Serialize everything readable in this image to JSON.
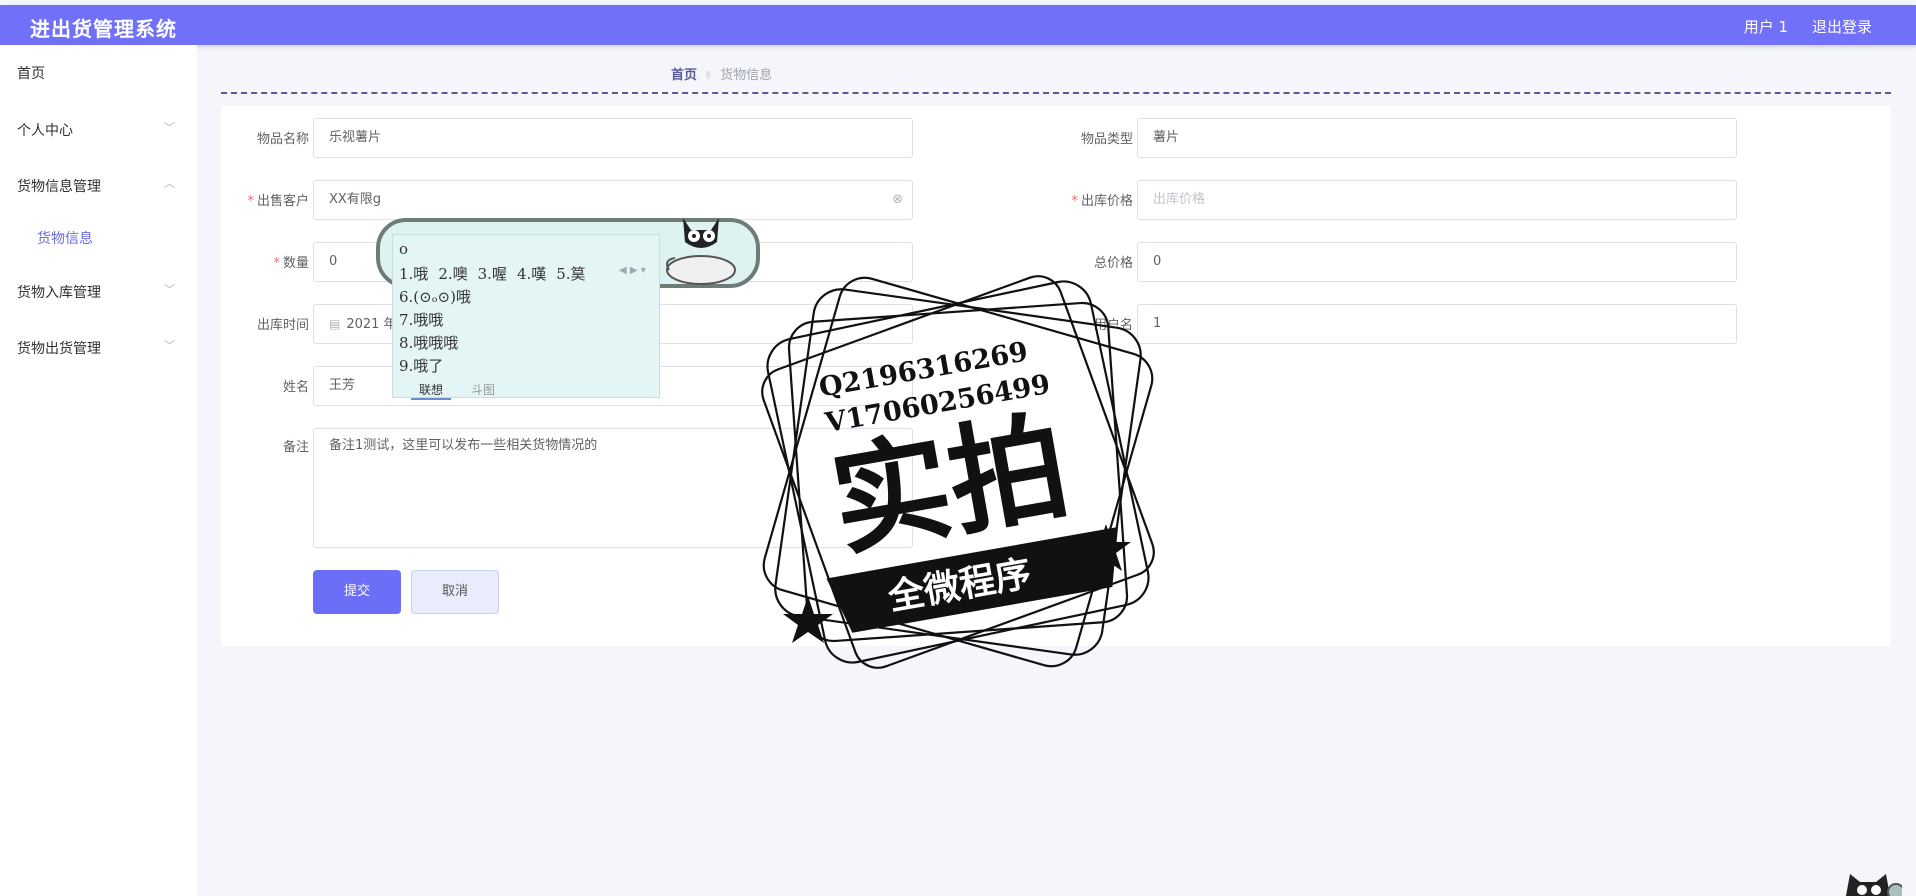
{
  "header": {
    "title": "进出货管理系统",
    "user": "用户 1",
    "logout": "退出登录"
  },
  "sidebar": {
    "items": [
      {
        "label": "首页",
        "has_chevron": false
      },
      {
        "label": "个人中心",
        "has_chevron": true,
        "chevron": "chevron-down-icon"
      },
      {
        "label": "货物信息管理",
        "has_chevron": true,
        "chevron": "chevron-up-icon"
      },
      {
        "label": "货物信息",
        "sub": true
      },
      {
        "label": "货物入库管理",
        "has_chevron": true,
        "chevron": "chevron-down-icon"
      },
      {
        "label": "货物出货管理",
        "has_chevron": true,
        "chevron": "chevron-down-icon"
      }
    ]
  },
  "breadcrumb": {
    "home": "首页",
    "current": "货物信息"
  },
  "form": {
    "item_name": {
      "label": "物品名称",
      "value": "乐视薯片"
    },
    "item_type": {
      "label": "物品类型",
      "value": "薯片"
    },
    "customer": {
      "label": "出售客户",
      "value": "XX有限g",
      "required": true
    },
    "out_price": {
      "label": "出库价格",
      "placeholder": "出库价格",
      "required": true
    },
    "quantity": {
      "label": "数量",
      "value": "0",
      "required": true
    },
    "total_price": {
      "label": "总价格",
      "value": "0"
    },
    "out_time": {
      "label": "出库时间",
      "value": "2021 年"
    },
    "username": {
      "label": "用户名",
      "value": "1"
    },
    "name": {
      "label": "姓名",
      "value": "王芳"
    },
    "remark": {
      "label": "备注",
      "value": "备注1测试，这里可以发布一些相关货物情况的"
    },
    "submit": "提交",
    "cancel": "取消"
  },
  "ime": {
    "composition": "o",
    "candidates_row": [
      "1.哦",
      "2.噢",
      "3.喔",
      "4.嘆",
      "5.筽"
    ],
    "candidates_col": [
      "6.(⊙ₒ⊙)哦",
      "7.哦哦",
      "8.哦哦哦",
      "9.哦了"
    ],
    "tab_active": "联想",
    "tab_other": "斗图"
  },
  "watermark": {
    "line1": "Q2196316269",
    "line2": "V17060256499",
    "big": "实拍",
    "banner": "全微程序"
  },
  "colors": {
    "header": "#7070f8",
    "primary": "#6d6ef7",
    "required": "#f56c6c",
    "accent": "#5a5a9a"
  }
}
